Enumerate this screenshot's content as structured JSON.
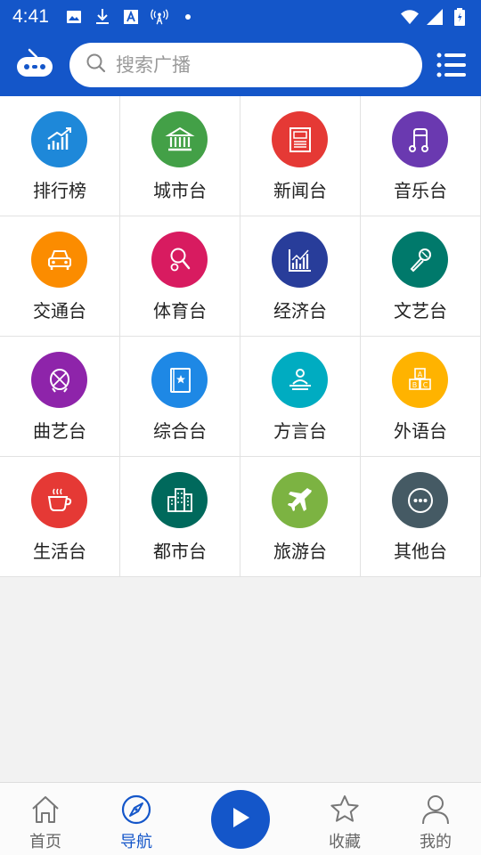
{
  "status_bar": {
    "time": "4:41",
    "left_icons": [
      "image-icon",
      "download-icon",
      "font-icon",
      "broadcast-icon",
      "dot-icon"
    ],
    "right_icons": [
      "wifi-icon",
      "signal-icon",
      "battery-icon"
    ]
  },
  "header": {
    "logo": "radio-icon",
    "search_placeholder": "搜索广播",
    "menu_icon": "menu-icon"
  },
  "categories": [
    {
      "label": "排行榜",
      "color": "#1e88d9",
      "icon": "chart-icon"
    },
    {
      "label": "城市台",
      "color": "#43a047",
      "icon": "building-icon"
    },
    {
      "label": "新闻台",
      "color": "#e53935",
      "icon": "newspaper-icon"
    },
    {
      "label": "音乐台",
      "color": "#6a39b0",
      "icon": "music-icon"
    },
    {
      "label": "交通台",
      "color": "#fb8c00",
      "icon": "car-icon"
    },
    {
      "label": "体育台",
      "color": "#d81b60",
      "icon": "racket-icon"
    },
    {
      "label": "经济台",
      "color": "#283d9a",
      "icon": "economy-chart-icon"
    },
    {
      "label": "文艺台",
      "color": "#00796b",
      "icon": "microphone-icon"
    },
    {
      "label": "曲艺台",
      "color": "#8e24aa",
      "icon": "opera-icon"
    },
    {
      "label": "综合台",
      "color": "#1e88e5",
      "icon": "book-icon"
    },
    {
      "label": "方言台",
      "color": "#00acc1",
      "icon": "speaker-icon"
    },
    {
      "label": "外语台",
      "color": "#ffb300",
      "icon": "abc-blocks-icon"
    },
    {
      "label": "生活台",
      "color": "#e53935",
      "icon": "coffee-icon"
    },
    {
      "label": "都市台",
      "color": "#00695c",
      "icon": "city-icon"
    },
    {
      "label": "旅游台",
      "color": "#7cb342",
      "icon": "plane-icon"
    },
    {
      "label": "其他台",
      "color": "#455a64",
      "icon": "more-icon"
    }
  ],
  "bottom_nav": {
    "home": "首页",
    "navigate": "导航",
    "favorites": "收藏",
    "mine": "我的",
    "active": "导航"
  },
  "colors": {
    "brand": "#1456c9",
    "inactive": "#666666"
  }
}
